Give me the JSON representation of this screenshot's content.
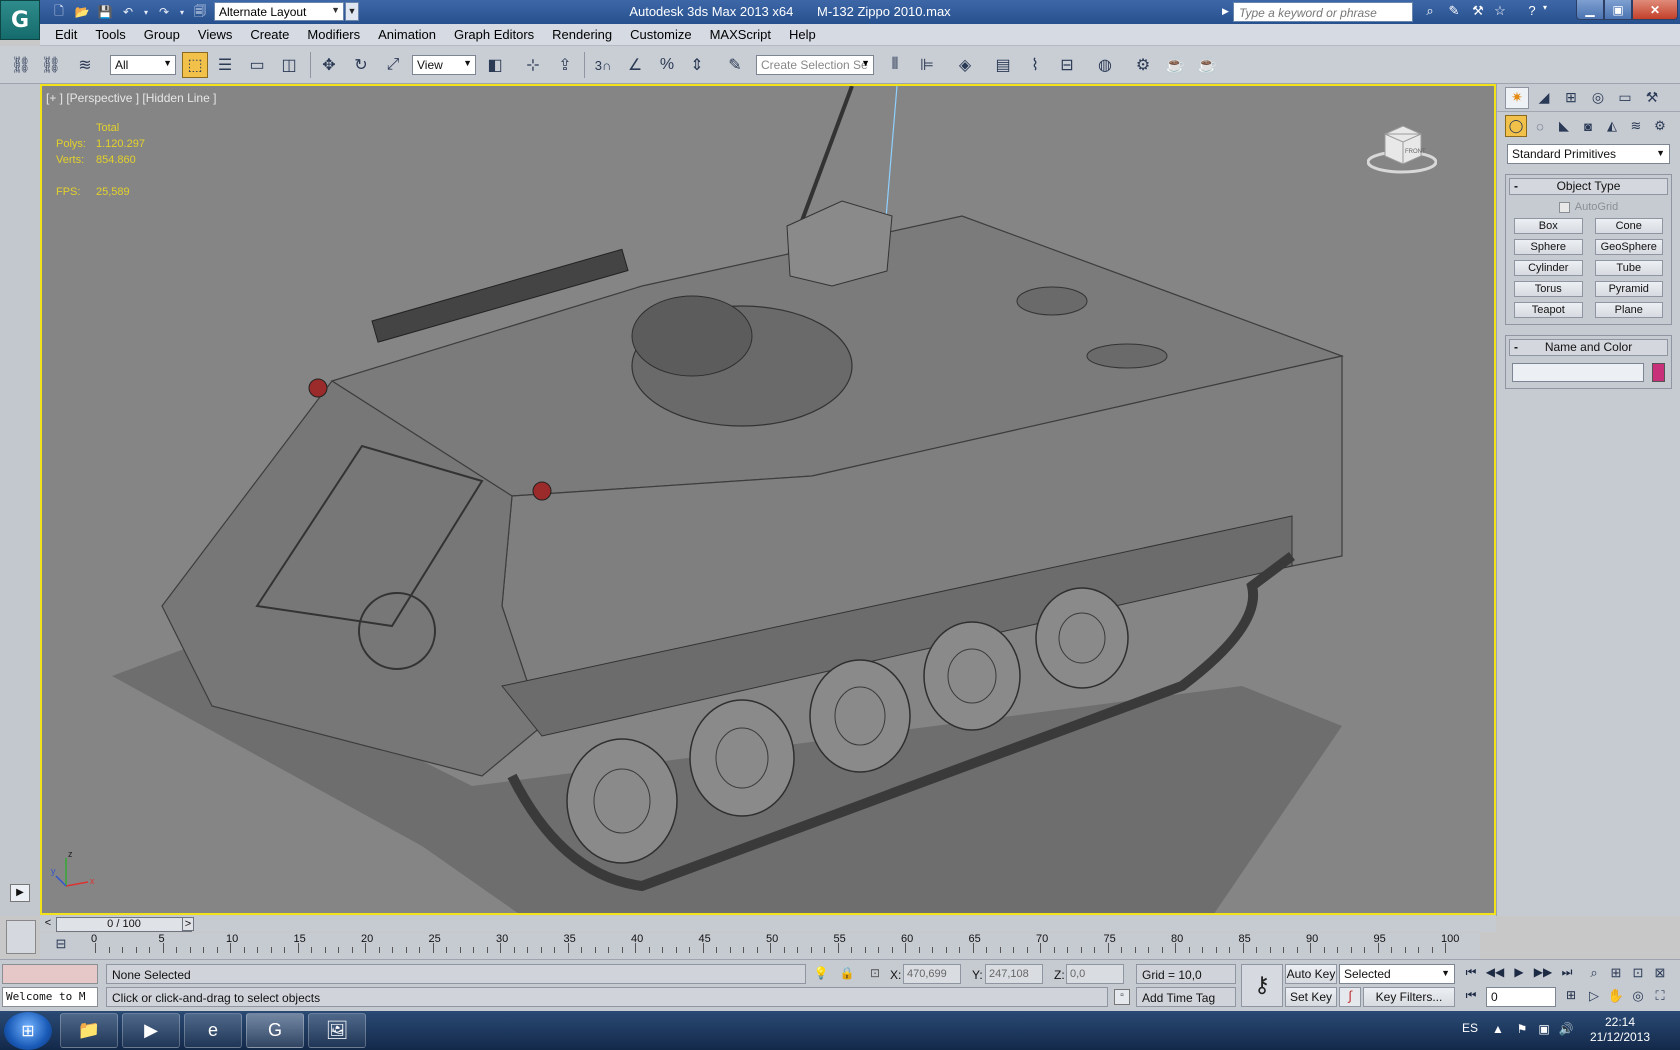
{
  "title_bar": {
    "app_name": "Autodesk 3ds Max  2013 x64",
    "file_name": "M-132 Zippo 2010.max",
    "workspace": "Alternate Layout",
    "search_placeholder": "Type a keyword or phrase",
    "logo_glyph": "G"
  },
  "menu": [
    "Edit",
    "Tools",
    "Group",
    "Views",
    "Create",
    "Modifiers",
    "Animation",
    "Graph Editors",
    "Rendering",
    "Customize",
    "MAXScript",
    "Help"
  ],
  "toolbar": {
    "selection_filter": "All",
    "reference_coord": "View",
    "named_selection_placeholder": "Create Selection Se",
    "snap_label": "3"
  },
  "viewport": {
    "label": "[+ ] [Perspective ] [Hidden Line ]",
    "stats": {
      "total_label": "Total",
      "polys_label": "Polys:",
      "polys_value": "1.120.297",
      "verts_label": "Verts:",
      "verts_value": "854.860",
      "fps_label": "FPS:",
      "fps_value": "25,589"
    },
    "viewcube_label": "FRONT",
    "axes": {
      "x": "x",
      "y": "y",
      "z": "z"
    }
  },
  "command_panel": {
    "category": "Standard Primitives",
    "object_type_title": "Object Type",
    "autogrid_label": "AutoGrid",
    "primitives": [
      "Box",
      "Cone",
      "Sphere",
      "GeoSphere",
      "Cylinder",
      "Tube",
      "Torus",
      "Pyramid",
      "Teapot",
      "Plane"
    ],
    "name_color_title": "Name and Color",
    "object_color": "#c9307a"
  },
  "time_slider": {
    "position": "0 / 100",
    "prev": "<",
    "next": ">"
  },
  "track_bar": {
    "tick_labels": [
      "0",
      "5",
      "10",
      "15",
      "20",
      "25",
      "30",
      "35",
      "40",
      "45",
      "50",
      "55",
      "60",
      "65",
      "70",
      "75",
      "80",
      "85",
      "90",
      "95",
      "100"
    ]
  },
  "status_bar": {
    "listener_text": "Welcome to M",
    "selection": "None Selected",
    "prompt": "Click or click-and-drag to select objects",
    "x_label": "X:",
    "x_value": "470,699",
    "y_label": "Y:",
    "y_value": "247,108",
    "z_label": "Z:",
    "z_value": "0,0",
    "grid": "Grid = 10,0",
    "add_time_tag": "Add Time Tag",
    "auto_key": "Auto Key",
    "set_key": "Set Key",
    "key_mode": "Selected",
    "key_filters": "Key Filters...",
    "current_frame": "0"
  },
  "taskbar": {
    "language": "ES",
    "time": "22:14",
    "date": "21/12/2013"
  }
}
